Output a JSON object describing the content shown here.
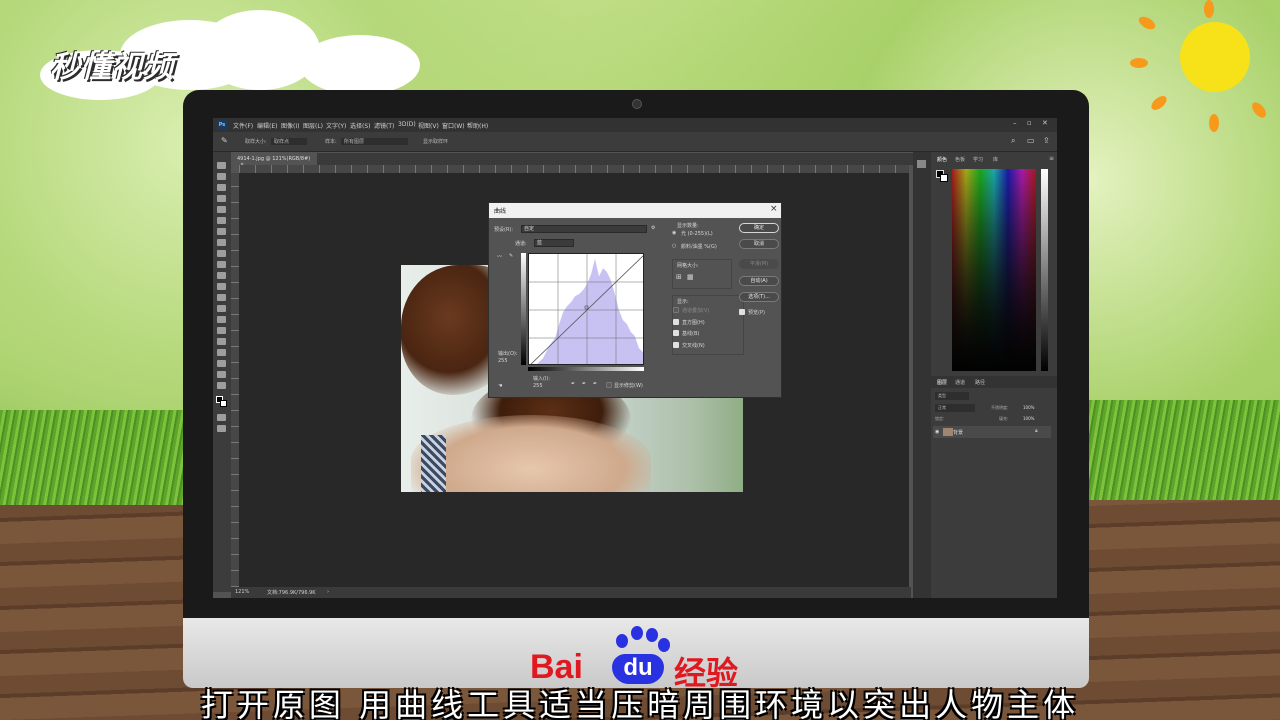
{
  "brand": {
    "logo_text": "秒懂视频",
    "footer_brand_left": "Bai",
    "footer_brand_du": "du",
    "footer_brand_right": "经验"
  },
  "subtitle": "打开原图  用曲线工具适当压暗周围环境以突出人物主体",
  "photoshop": {
    "menu": [
      "文件(F)",
      "编辑(E)",
      "图像(I)",
      "图层(L)",
      "文字(Y)",
      "选择(S)",
      "滤镜(T)",
      "3D(D)",
      "视图(V)",
      "窗口(W)",
      "帮助(H)"
    ],
    "options": {
      "brush_size_label": "取样大小:",
      "brush_size_value": "取样点",
      "sample_label": "样本:",
      "sample_value": "所有图层",
      "show_ring": "显示取样环"
    },
    "document_tab": "4914-1.jpg @ 121%(RGB/8#)",
    "status": {
      "zoom": "121%",
      "doc_size": "文档:796.9K/796.9K"
    },
    "curves_dialog": {
      "title": "曲线",
      "preset_label": "预设(R):",
      "preset_value": "自定",
      "channel_label": "通道:",
      "channel_value": "蓝",
      "output_label": "输出(O):",
      "output_value": "255",
      "input_label": "输入(I):",
      "input_value": "255",
      "show_clipping": "显示修剪(W)",
      "display_amount_label": "显示数量:",
      "light_option": "光 (0-255)(L)",
      "pigment_option": "颜料/油墨 %(G)",
      "grid_size_label": "网格大小:",
      "show_label": "显示:",
      "show_channel_overlays": "通道叠加(V)",
      "show_histogram": "直方图(H)",
      "show_baseline": "基线(B)",
      "show_intersection": "交叉线(N)",
      "ok_button": "确定",
      "cancel_button": "取消",
      "smooth_button": "平滑(M)",
      "auto_button": "自动(A)",
      "options_button": "选项(T)...",
      "preview_label": "预览(P)"
    },
    "panels": {
      "color_tabs": [
        "颜色",
        "色板",
        "学习",
        "库"
      ],
      "layers_tabs": [
        "图层",
        "通道",
        "路径"
      ],
      "layer_kind": "类型",
      "blend_mode": "正常",
      "opacity_label": "不透明度:",
      "opacity_value": "100%",
      "lock_label": "锁定:",
      "fill_label": "填充:",
      "fill_value": "100%",
      "layer_name": "背景"
    }
  },
  "colors": {
    "ps_dark": "#323232",
    "ps_panel": "#3c3c3c",
    "accent_red": "#e0181f",
    "accent_blue": "#2932e1"
  }
}
